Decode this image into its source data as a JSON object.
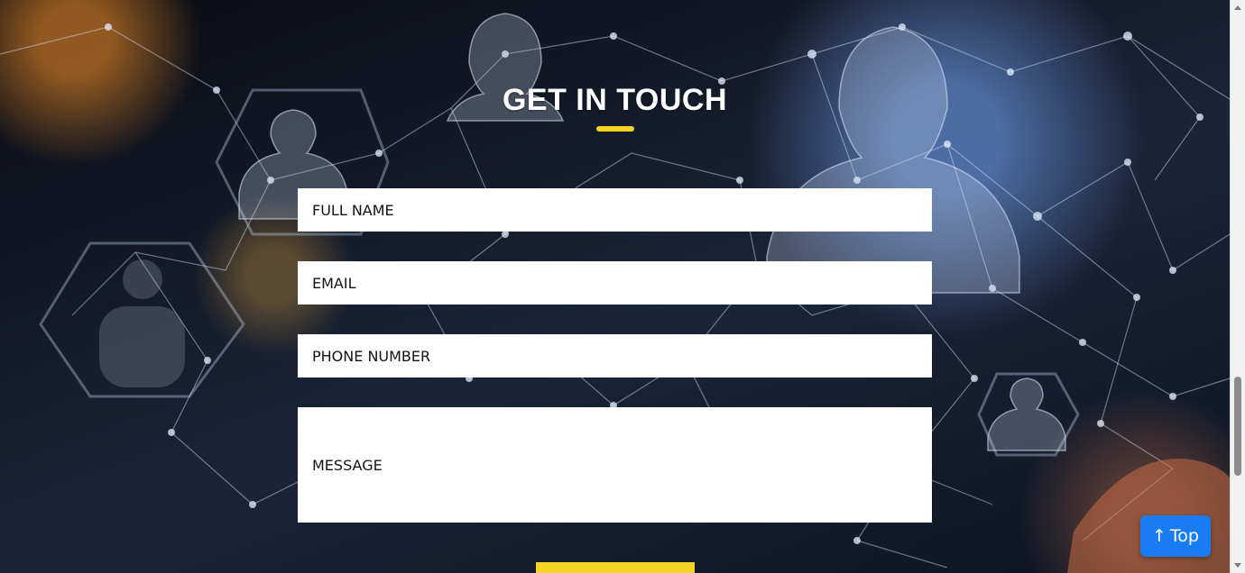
{
  "section": {
    "title": "GET IN TOUCH"
  },
  "form": {
    "full_name_placeholder": "FULL NAME",
    "email_placeholder": "EMAIL",
    "phone_placeholder": "PHONE NUMBER",
    "message_placeholder": "MESSAGE"
  },
  "top_button": {
    "arrow": "↑",
    "label": "Top"
  },
  "colors": {
    "accent_yellow": "#f5d523",
    "top_button_blue": "#1a7cf2",
    "title_text": "#ffffff"
  },
  "icons": {
    "top_arrow": "arrow-up-icon"
  }
}
